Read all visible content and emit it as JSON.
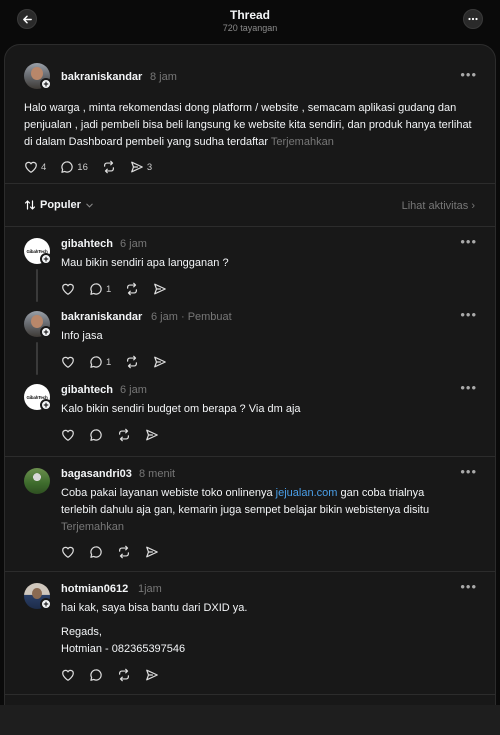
{
  "header": {
    "title": "Thread",
    "views": "720 tayangan"
  },
  "original_post": {
    "username": "bakraniskandar",
    "time": "8 jam",
    "text": "Halo warga , minta rekomendasi dong platform / website , semacam aplikasi gudang dan penjualan , jadi pembeli bisa beli langsung ke website kita sendiri, dan produk hanya terlihat di dalam Dashboard pembeli yang sudha terdaftar",
    "translate": "Terjemahkan",
    "likes": "4",
    "replies": "16",
    "shares": "3"
  },
  "sort": {
    "label": "Populer",
    "activity": "Lihat aktivitas"
  },
  "replies": [
    {
      "username": "gibahtech",
      "time": "6 jam",
      "text": "Mau bikin sendiri apa langganan ?",
      "reply_count": "1",
      "avatar_text": "GibahTech"
    },
    {
      "username": "bakraniskandar",
      "time": "6 jam",
      "author_tag": "Pembuat",
      "text": "Info jasa",
      "reply_count": "1"
    },
    {
      "username": "gibahtech",
      "time": "6 jam",
      "text": "Kalo bikin sendiri budget om berapa ? Via dm aja",
      "avatar_text": "GibahTech"
    },
    {
      "username": "bagasandri03",
      "time": "8 menit",
      "text_before": "Coba pakai layanan webiste toko onlinenya ",
      "link": "jejualan.com",
      "text_after": " gan coba trialnya terlebih dahulu aja gan, kemarin juga sempet belajar bikin webistenya disitu",
      "translate": "Terjemahkan"
    },
    {
      "username": "hotmian0612",
      "time": "1jam",
      "text": "hai kak, saya bisa bantu dari DXID ya.",
      "text2": "Regads,",
      "text3": "Hotmian - 082365397546"
    }
  ],
  "colors": {
    "background": "#0a0a0a",
    "card": "#181818",
    "muted": "#777777",
    "link": "#4a9fe8"
  }
}
